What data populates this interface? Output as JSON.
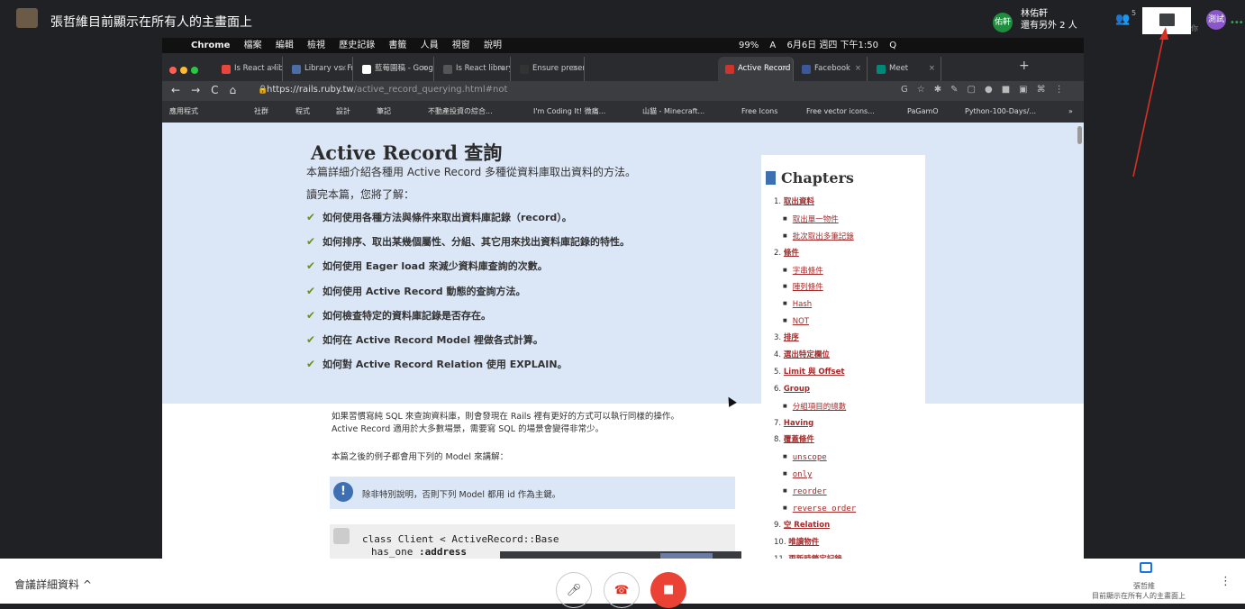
{
  "meet": {
    "presenting_banner": "張哲維目前顯示在所有人的主畫面上",
    "user_badge": "佑軒",
    "user_name": "林佑軒",
    "user_others": "還有另外 2 人",
    "people_count": "5",
    "you_label": "你",
    "you_avatar": "測試",
    "meeting_details": "會議詳細資料 ^",
    "presenter_name": "張哲維",
    "presenter_status": "目前顯示在所有人的主畫面上",
    "icons": [
      "people-icon",
      "chat-icon",
      "mic-off-icon",
      "hangup-icon",
      "camera-off-icon",
      "present-icon",
      "more-vert-icon"
    ],
    "colors": {
      "accent": "#1a73e8",
      "danger": "#ea4335",
      "user_badge": "#1e8e3e",
      "you_avatar": "#8a56c9"
    }
  },
  "mac_menubar": {
    "apple": "",
    "items": [
      "Chrome",
      "檔案",
      "編輯",
      "檢視",
      "歷史記錄",
      "書籤",
      "人員",
      "視窗",
      "說明"
    ],
    "status": [
      "99%",
      "A",
      "6月6日 週四 下午1:50",
      "Q"
    ]
  },
  "browser": {
    "tabs": [
      {
        "title": "Is React a library",
        "color": "#e8453c"
      },
      {
        "title": "Library vs. Frame",
        "color": "#4a6fa5"
      },
      {
        "title": "藍莓園稿 - Goog",
        "color": "#ffffff"
      },
      {
        "title": "Is React library o",
        "color": "#555555"
      },
      {
        "title": "Ensure presence",
        "color": "#333333"
      },
      {
        "title": "Active Record 查",
        "color": "#cc342d"
      },
      {
        "title": "Facebook",
        "color": "#3b5998"
      },
      {
        "title": "Meet",
        "color": "#00897b"
      }
    ],
    "new_tab": "+",
    "url_host": "https://rails.ruby.tw",
    "url_path": "/active_record_querying.html#not",
    "nav": [
      "←",
      "→",
      "C",
      "⌂"
    ],
    "bookmarks": [
      "應用程式",
      "社群",
      "程式",
      "設計",
      "筆記",
      "不動產投資の綜合...",
      "I'm Coding It! 微痛...",
      "山貓 - Minecraft...",
      "Free Icons",
      "Free vector icons...",
      "PaGamO",
      "Python-100-Days/...",
      "»"
    ]
  },
  "page": {
    "title": "Active Record 查詢",
    "intro": "本篇詳細介紹各種用 Active Record 多種從資料庫取出資料的方法。",
    "learn": "讀完本篇，您將了解：",
    "goals": [
      "如何使用各種方法與條件來取出資料庫記錄（record）。",
      "如何排序、取出某幾個屬性、分組、其它用來找出資料庫記錄的特性。",
      "如何使用 Eager load 來減少資料庫查詢的次數。",
      "如何使用 Active Record 動態的查詢方法。",
      "如何檢查特定的資料庫記錄是否存在。",
      "如何在 Active Record Model 裡做各式計算。",
      "如何對 Active Record Relation 使用 EXPLAIN。"
    ],
    "para_line1": "如果習慣寫純 SQL 來查詢資料庫，則會發現在 Rails 裡有更好的方式可以執行同樣的操作。",
    "para_line2": "Active Record 適用於大多數場景，需要寫 SQL 的場景會變得非常少。",
    "para2": "本篇之後的例子都會用下列的 Model 來講解：",
    "notice": "除非特別說明，否則下列 Model 都用 id 作為主鍵。",
    "notice_icon": "!",
    "code_line1": "class Client < ActiveRecord::Base",
    "code_kw": "has_one",
    "code_sym": ":address",
    "chapters_heading": "Chapters",
    "toc": [
      {
        "num": "1.",
        "label": "取出資料",
        "sub": false,
        "mono": false
      },
      {
        "num": "",
        "label": "取出單一物件",
        "sub": true,
        "mono": false
      },
      {
        "num": "",
        "label": "批次取出多筆記錄",
        "sub": true,
        "mono": false
      },
      {
        "num": "2.",
        "label": "條件",
        "sub": false,
        "mono": false
      },
      {
        "num": "",
        "label": "字串條件",
        "sub": true,
        "mono": false
      },
      {
        "num": "",
        "label": "陣列條件",
        "sub": true,
        "mono": false
      },
      {
        "num": "",
        "label": "Hash",
        "sub": true,
        "mono": false
      },
      {
        "num": "",
        "label": "NOT",
        "sub": true,
        "mono": false
      },
      {
        "num": "3.",
        "label": "排序",
        "sub": false,
        "mono": false
      },
      {
        "num": "4.",
        "label": "選出特定欄位",
        "sub": false,
        "mono": false
      },
      {
        "num": "5.",
        "label": "Limit 與 Offset",
        "sub": false,
        "mono": false
      },
      {
        "num": "6.",
        "label": "Group",
        "sub": false,
        "mono": false
      },
      {
        "num": "",
        "label": "分組項目的總數",
        "sub": true,
        "mono": false
      },
      {
        "num": "7.",
        "label": "Having",
        "sub": false,
        "mono": false
      },
      {
        "num": "8.",
        "label": "覆蓋條件",
        "sub": false,
        "mono": false
      },
      {
        "num": "",
        "label": "unscope",
        "sub": true,
        "mono": true
      },
      {
        "num": "",
        "label": "only",
        "sub": true,
        "mono": true
      },
      {
        "num": "",
        "label": "reorder",
        "sub": true,
        "mono": true
      },
      {
        "num": "",
        "label": "reverse_order",
        "sub": true,
        "mono": true
      },
      {
        "num": "9.",
        "label": "空 Relation",
        "sub": false,
        "mono": false
      },
      {
        "num": "10.",
        "label": "唯讀物件",
        "sub": false,
        "mono": false
      },
      {
        "num": "11.",
        "label": "更新時鎖定記錄",
        "sub": false,
        "mono": false
      }
    ]
  }
}
